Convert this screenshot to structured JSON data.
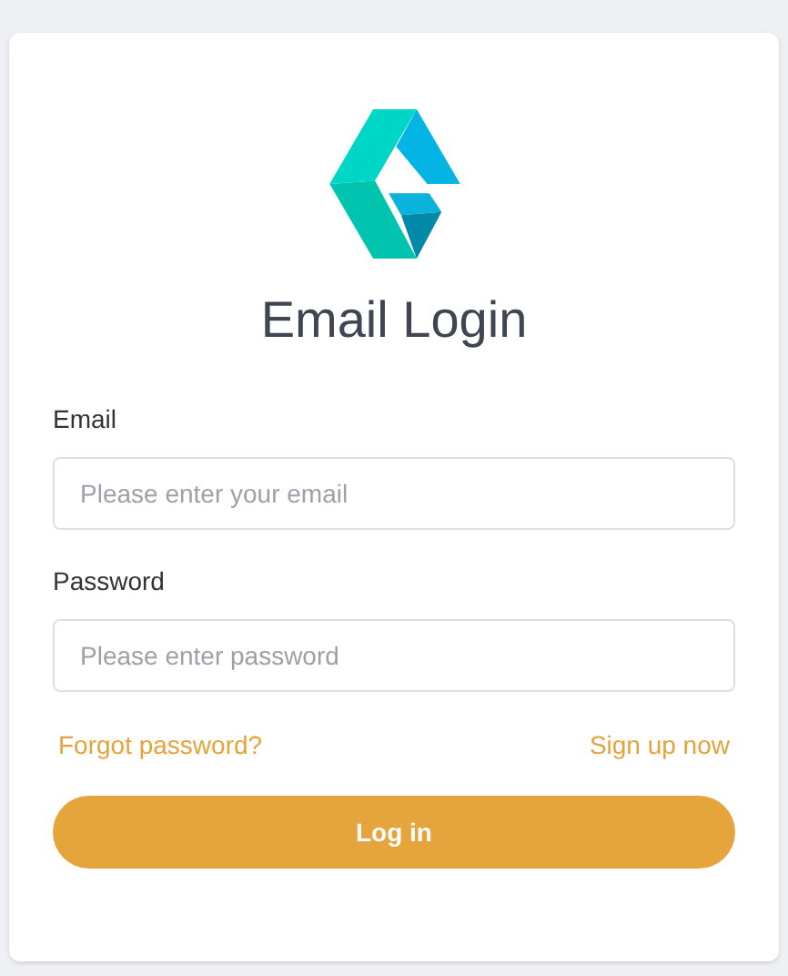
{
  "title": "Email Login",
  "fields": [
    {
      "label": "Email",
      "placeholder": "Please enter your email"
    },
    {
      "label": "Password",
      "placeholder": "Please enter password"
    }
  ],
  "links": [
    "Forgot password?",
    "Sign up now"
  ],
  "button": "Log in"
}
